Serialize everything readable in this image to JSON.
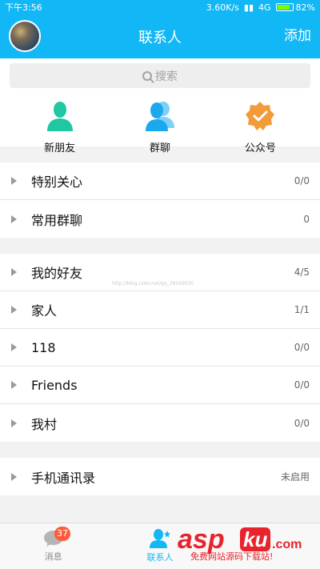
{
  "status_bar": {
    "time": "下午3:56",
    "network_speed": "3.60K/s",
    "network": "4G",
    "battery": "82%"
  },
  "header": {
    "title": "联系人",
    "add_label": "添加"
  },
  "search": {
    "placeholder": "搜索"
  },
  "quick_actions": [
    {
      "label": "新朋友",
      "icon": "person-icon",
      "color": "#1fc8a1"
    },
    {
      "label": "群聊",
      "icon": "group-icon",
      "color": "#1aa9ee"
    },
    {
      "label": "公众号",
      "icon": "badge-check-icon",
      "color": "#f29b38"
    }
  ],
  "groups": [
    [
      {
        "label": "特别关心",
        "count": "0/0"
      },
      {
        "label": "常用群聊",
        "count": "0"
      }
    ],
    [
      {
        "label": "我的好友",
        "count": "4/5"
      },
      {
        "label": "家人",
        "count": "1/1"
      },
      {
        "label": "118",
        "count": "0/0"
      },
      {
        "label": "Friends",
        "count": "0/0"
      },
      {
        "label": "我村",
        "count": "0/0"
      }
    ],
    [
      {
        "label": "手机通讯录",
        "count": "未启用"
      }
    ]
  ],
  "watermark": "http://blog.csdn.net/qq_29269035",
  "bottom_tabs": {
    "messages_label": "消息",
    "messages_badge": "37",
    "contacts_label": "联系人"
  },
  "logo": {
    "text": "aspku",
    "domain": ".com",
    "slogan": "免费网站源码下载站!"
  },
  "colors": {
    "primary": "#12b7f5",
    "badge": "#ff5a3c"
  }
}
